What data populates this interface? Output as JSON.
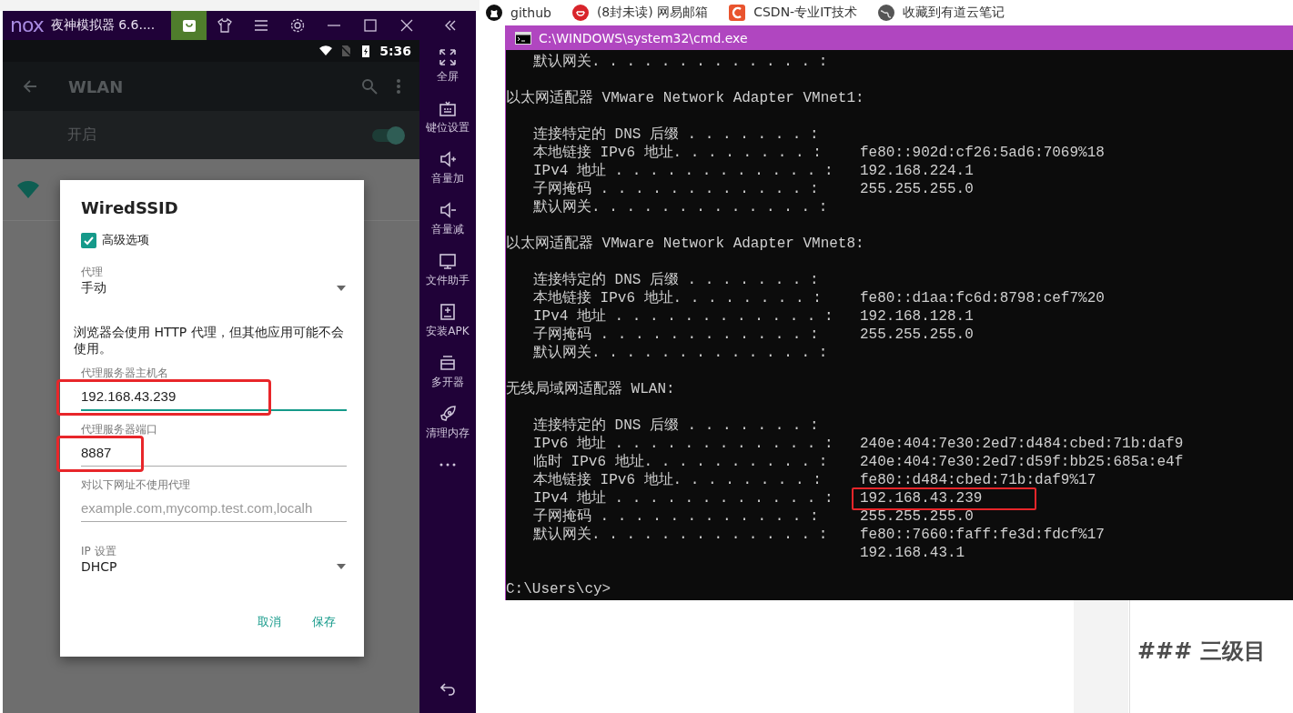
{
  "browser": {
    "bookmarks": [
      {
        "label": "github",
        "kind": "github"
      },
      {
        "label": "(8封未读) 网易邮箱",
        "kind": "mail"
      },
      {
        "label": "CSDN-专业IT技术",
        "kind": "csdn"
      },
      {
        "label": "收藏到有道云笔记",
        "kind": "globe"
      }
    ],
    "heading": "### 三级目"
  },
  "emulator": {
    "logo": "nox",
    "title": "夜神模拟器 6.6....",
    "status_bar": {
      "time": "5:36"
    },
    "app_bar": {
      "title": "WLAN"
    },
    "wifi_toggle": {
      "label": "开启",
      "on": true
    },
    "sidebar": [
      {
        "kind": "fullscreen",
        "label": "全屏"
      },
      {
        "kind": "keyboard",
        "label": "键位设置"
      },
      {
        "kind": "volume-up",
        "label": "音量加"
      },
      {
        "kind": "volume-down",
        "label": "音量减"
      },
      {
        "kind": "files",
        "label": "文件助手"
      },
      {
        "kind": "apk",
        "label": "安装APK"
      },
      {
        "kind": "multi",
        "label": "多开器"
      },
      {
        "kind": "clean",
        "label": "清理内存"
      },
      {
        "kind": "more"
      },
      {
        "kind": "back"
      }
    ],
    "dialog": {
      "title": "WiredSSID",
      "advanced": {
        "label": "高级选项",
        "checked": true
      },
      "proxy": {
        "label": "代理",
        "value": "手动"
      },
      "note": "浏览器会使用 HTTP 代理，但其他应用可能不会使用。",
      "fields": [
        {
          "label": "代理服务器主机名",
          "value": "192.168.43.239",
          "focused": true,
          "highlighted": true
        },
        {
          "label": "代理服务器端口",
          "value": "8887",
          "focused": false,
          "highlighted": true
        },
        {
          "label": "对以下网址不使用代理",
          "placeholder": "example.com,mycomp.test.com,localh",
          "focused": false
        }
      ],
      "ip_settings": {
        "label": "IP 设置",
        "value": "DHCP"
      },
      "buttons": [
        "取消",
        "保存"
      ]
    }
  },
  "cmd": {
    "title": "C:\\WINDOWS\\system32\\cmd.exe",
    "lines": [
      {
        "kind": "entry",
        "label": "默认网关. . . . . . . . . . . . . :"
      },
      {
        "kind": "blank"
      },
      {
        "kind": "header",
        "text": "以太网适配器 VMware Network Adapter VMnet1:"
      },
      {
        "kind": "blank"
      },
      {
        "kind": "entry",
        "label": "连接特定的 DNS 后缀 . . . . . . . :"
      },
      {
        "kind": "entry",
        "label": "本地链接 IPv6 地址. . . . . . . . :",
        "value": "fe80::902d:cf26:5ad6:7069%18"
      },
      {
        "kind": "entry",
        "label": "IPv4 地址 . . . . . . . . . . . . :",
        "value": "192.168.224.1"
      },
      {
        "kind": "entry",
        "label": "子网掩码  . . . . . . . . . . . . :",
        "value": "255.255.255.0"
      },
      {
        "kind": "entry",
        "label": "默认网关. . . . . . . . . . . . . :"
      },
      {
        "kind": "blank"
      },
      {
        "kind": "header",
        "text": "以太网适配器 VMware Network Adapter VMnet8:"
      },
      {
        "kind": "blank"
      },
      {
        "kind": "entry",
        "label": "连接特定的 DNS 后缀 . . . . . . . :"
      },
      {
        "kind": "entry",
        "label": "本地链接 IPv6 地址. . . . . . . . :",
        "value": "fe80::d1aa:fc6d:8798:cef7%20"
      },
      {
        "kind": "entry",
        "label": "IPv4 地址 . . . . . . . . . . . . :",
        "value": "192.168.128.1"
      },
      {
        "kind": "entry",
        "label": "子网掩码  . . . . . . . . . . . . :",
        "value": "255.255.255.0"
      },
      {
        "kind": "entry",
        "label": "默认网关. . . . . . . . . . . . . :"
      },
      {
        "kind": "blank"
      },
      {
        "kind": "header",
        "text": "无线局域网适配器 WLAN:"
      },
      {
        "kind": "blank"
      },
      {
        "kind": "entry",
        "label": "连接特定的 DNS 后缀 . . . . . . . :"
      },
      {
        "kind": "entry",
        "label": "IPv6 地址 . . . . . . . . . . . . :",
        "value": "240e:404:7e30:2ed7:d484:cbed:71b:daf9"
      },
      {
        "kind": "entry",
        "label": "临时 IPv6 地址. . . . . . . . . . :",
        "value": "240e:404:7e30:2ed7:d59f:bb25:685a:e4f"
      },
      {
        "kind": "entry",
        "label": "本地链接 IPv6 地址. . . . . . . . :",
        "value": "fe80::d484:cbed:71b:daf9%17"
      },
      {
        "kind": "entry",
        "label": "IPv4 地址 . . . . . . . . . . . . :",
        "value": "192.168.43.239",
        "highlighted": true
      },
      {
        "kind": "entry",
        "label": "子网掩码  . . . . . . . . . . . . :",
        "value": "255.255.255.0"
      },
      {
        "kind": "entry",
        "label": "默认网关. . . . . . . . . . . . . :",
        "value": "fe80::7660:faff:fe3d:fdcf%17"
      },
      {
        "kind": "continuation",
        "value": "192.168.43.1"
      },
      {
        "kind": "blank"
      },
      {
        "kind": "prompt",
        "text": "C:\\Users\\cy>"
      }
    ]
  }
}
